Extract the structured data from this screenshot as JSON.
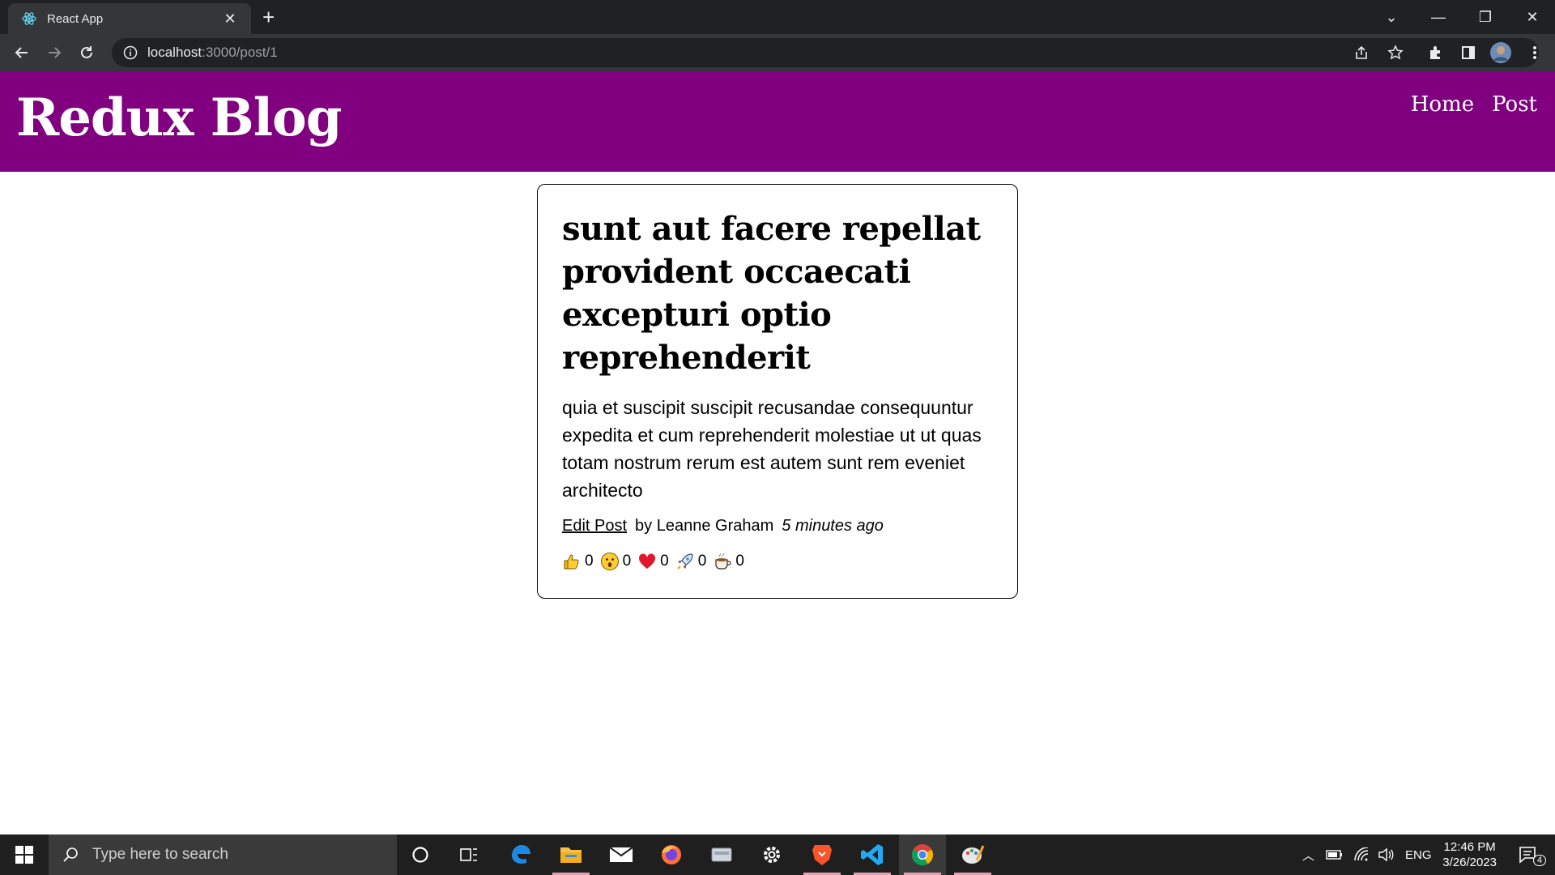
{
  "browser": {
    "tab_title": "React App",
    "url_host": "localhost",
    "url_path": ":3000/post/1"
  },
  "site": {
    "brand": "Redux Blog",
    "nav": [
      "Home",
      "Post"
    ],
    "header_color": "#800080"
  },
  "post": {
    "title": "sunt aut facere repellat provident occaecati excepturi optio reprehenderit",
    "body": "quia et suscipit suscipit recusandae consequuntur expedita et cum reprehenderit molestiae ut ut quas totam nostrum rerum est autem sunt rem eveniet architecto",
    "edit_label": "Edit Post",
    "author": "by Leanne Graham",
    "time": "5 minutes ago",
    "reactions": [
      {
        "icon": "thumbs-up-icon",
        "count": "0"
      },
      {
        "icon": "wow-face-icon",
        "count": "0"
      },
      {
        "icon": "heart-icon",
        "count": "0"
      },
      {
        "icon": "rocket-icon",
        "count": "0"
      },
      {
        "icon": "coffee-icon",
        "count": "0"
      }
    ]
  },
  "taskbar": {
    "search_placeholder": "Type here to search",
    "language": "ENG",
    "time": "12:46 PM",
    "date": "3/26/2023",
    "notification_count": "4"
  }
}
